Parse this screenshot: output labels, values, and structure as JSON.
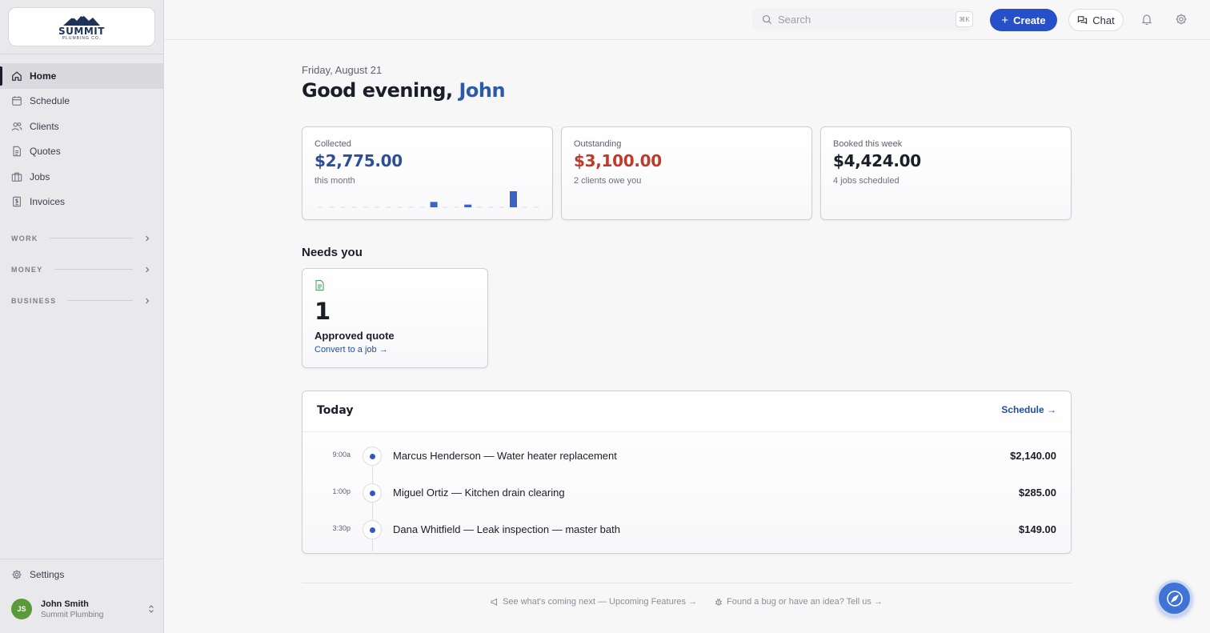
{
  "brand": {
    "logo_text": "SUMMIT",
    "logo_sub": "PLUMBING CO."
  },
  "sidebar": {
    "items": [
      {
        "label": "Home",
        "icon": "home-icon",
        "active": true
      },
      {
        "label": "Schedule",
        "icon": "calendar-icon"
      },
      {
        "label": "Clients",
        "icon": "users-icon"
      },
      {
        "label": "Quotes",
        "icon": "document-icon"
      },
      {
        "label": "Jobs",
        "icon": "briefcase-icon"
      },
      {
        "label": "Invoices",
        "icon": "invoice-icon"
      }
    ],
    "sections": [
      "WORK",
      "MONEY",
      "BUSINESS"
    ],
    "settings_label": "Settings",
    "user": {
      "initials": "JS",
      "name": "John Smith",
      "org": "Summit Plumbing"
    }
  },
  "topbar": {
    "search_placeholder": "Search",
    "search_shortcut": "⌘K",
    "create_label": "Create",
    "chat_label": "Chat"
  },
  "header": {
    "date": "Friday, August 21",
    "greeting": "Good evening,",
    "name": "John"
  },
  "stats": [
    {
      "label": "Collected",
      "value": "$2,775.00",
      "sub": "this month",
      "color": "#2d4f9a"
    },
    {
      "label": "Outstanding",
      "value": "$3,100.00",
      "sub": "2 clients owe you",
      "color": "#c0392b"
    },
    {
      "label": "Booked this week",
      "value": "$4,424.00",
      "sub": "4 jobs scheduled",
      "color": "#1a1e28"
    }
  ],
  "collected_daily": [
    0,
    0,
    0,
    0,
    0,
    0,
    0,
    0,
    0,
    0,
    6,
    0,
    0,
    3,
    0,
    0,
    0,
    18,
    0,
    0
  ],
  "needs_you": {
    "title": "Needs you",
    "count": "1",
    "label": "Approved quote",
    "link": "Convert to a job →"
  },
  "today": {
    "title": "Today",
    "link": "Schedule →",
    "rows": [
      {
        "time": "9:00a",
        "title": "Marcus Henderson — Water heater replacement",
        "amount": "$2,140.00"
      },
      {
        "time": "1:00p",
        "title": "Miguel Ortiz — Kitchen drain clearing",
        "amount": "$285.00"
      },
      {
        "time": "3:30p",
        "title": "Dana Whitfield — Leak inspection — master bath",
        "amount": "$149.00"
      }
    ]
  },
  "footer": {
    "upcoming": "See what's coming next — Upcoming Features →",
    "feedback": "Found a bug or have an idea? Tell us →"
  },
  "colors": {
    "accent": "#2550c7",
    "name_blue": "#2d5aa8",
    "bar": "#3a63c4"
  }
}
